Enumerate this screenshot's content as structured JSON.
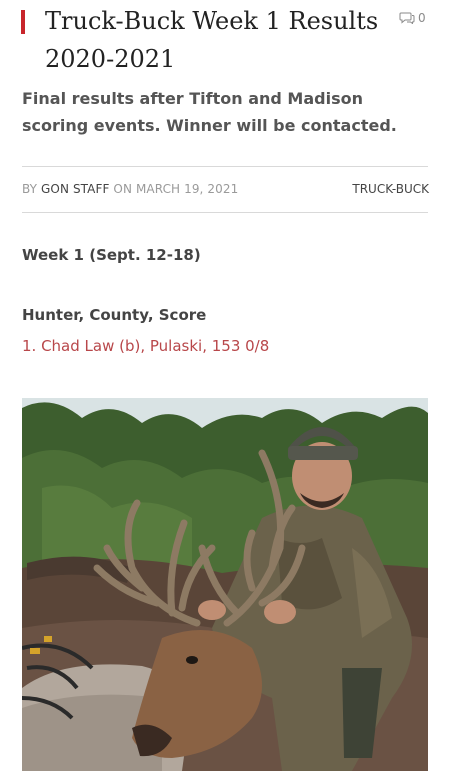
{
  "article": {
    "title_line1": "Truck-Buck Week 1 Results",
    "title_line2": "2020-2021",
    "comment_count": "0",
    "excerpt": "Final results after Tifton and Madison scoring events. Winner will be contacted."
  },
  "meta": {
    "by": "BY",
    "author": "GON STAFF",
    "on": "ON",
    "date": "MARCH 19, 2021",
    "category": "TRUCK-BUCK"
  },
  "content": {
    "week_heading": "Week 1 (Sept. 12-18)",
    "columns_heading": "Hunter, County, Score",
    "result_line": "1. Chad Law (b), Pulaski, 153 0/8"
  },
  "icons": {
    "comments": "comment-bubble-icon"
  },
  "colors": {
    "accent": "#c8252b",
    "link": "#b8474a"
  }
}
